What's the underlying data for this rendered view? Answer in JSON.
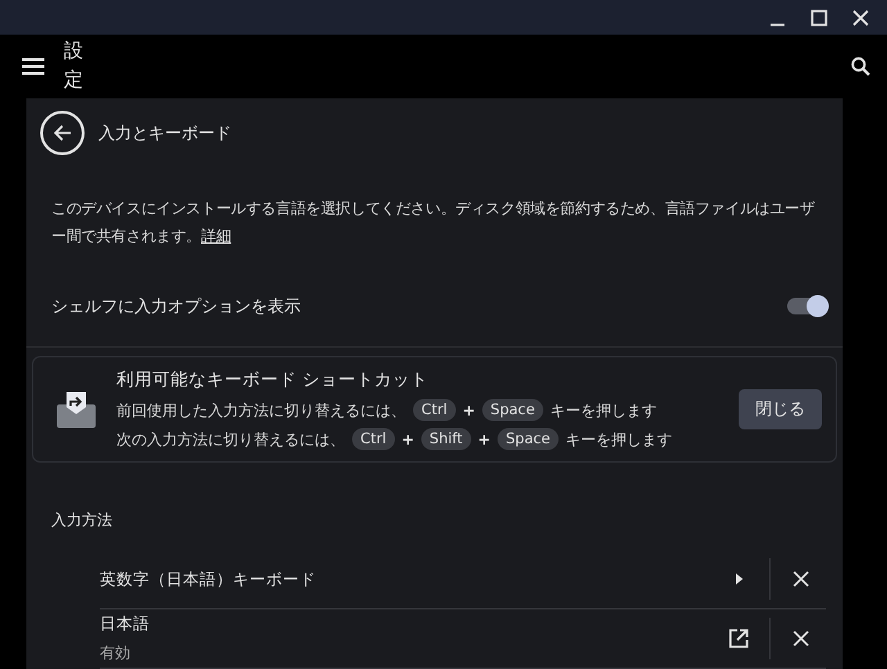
{
  "app_bar": {
    "title": "設定"
  },
  "page": {
    "title": "入力とキーボード",
    "description": "このデバイスにインストールする言語を選択してください。ディスク領域を節約するため、言語ファイルはユーザー間で共有されます。",
    "link": "詳細",
    "shelf_toggle": {
      "label": "シェルフに入力オプションを表示",
      "on": true
    },
    "shortcuts": {
      "title": "利用可能なキーボード ショートカット",
      "button": "閉じる",
      "lines": [
        [
          {
            "kind": "text",
            "text": "前回使用した入力方法に切り替えるには、"
          },
          {
            "kind": "key",
            "text": "Ctrl"
          },
          {
            "kind": "plus",
            "text": "+"
          },
          {
            "kind": "key",
            "text": "Space"
          },
          {
            "kind": "text",
            "text": "キーを押します"
          }
        ],
        [
          {
            "kind": "text",
            "text": "次の入力方法に切り替えるには、"
          },
          {
            "kind": "key",
            "text": "Ctrl"
          },
          {
            "kind": "plus",
            "text": "+"
          },
          {
            "kind": "key",
            "text": "Shift"
          },
          {
            "kind": "plus",
            "text": "+"
          },
          {
            "kind": "key",
            "text": "Space"
          },
          {
            "kind": "text",
            "text": "キーを押します"
          }
        ]
      ]
    },
    "methods_heading": "入力方法",
    "methods": [
      {
        "name": "英数字（日本語）キーボード",
        "kind": "submenu"
      },
      {
        "name": "日本語",
        "status": "有効",
        "kind": "external"
      }
    ]
  }
}
